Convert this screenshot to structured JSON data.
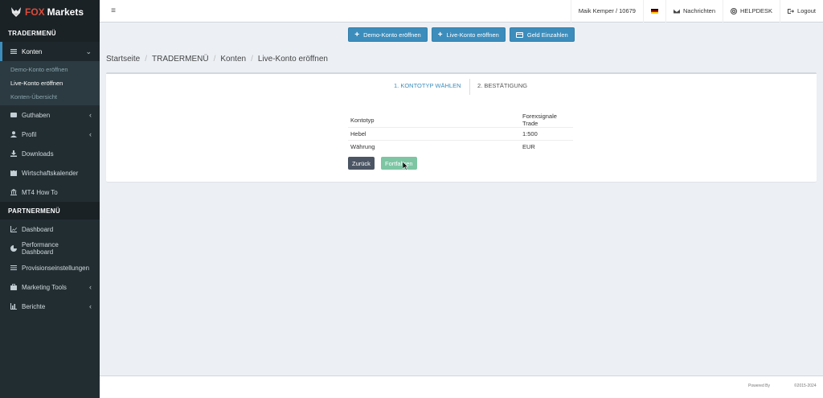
{
  "brand": {
    "fox": "FOX",
    "markets": "Markets"
  },
  "sidebar": {
    "trader_header": "TRADERMENÜ",
    "konten": {
      "label": "Konten"
    },
    "konten_sub": [
      {
        "label": "Demo-Konto eröffnen"
      },
      {
        "label": "Live-Konto eröffnen"
      },
      {
        "label": "Konten-Übersicht"
      }
    ],
    "trader_items": [
      {
        "label": "Guthaben"
      },
      {
        "label": "Profil"
      },
      {
        "label": "Downloads"
      },
      {
        "label": "Wirtschaftskalender"
      },
      {
        "label": "MT4 How To"
      }
    ],
    "partner_header": "PARTNERMENÜ",
    "partner_items": [
      {
        "label": "Dashboard"
      },
      {
        "label": "Performance Dashboard"
      },
      {
        "label": "Provisionseinstellungen"
      },
      {
        "label": "Marketing Tools"
      },
      {
        "label": "Berichte"
      }
    ]
  },
  "topbar": {
    "menu_toggle": "≡",
    "user": "Maik Kemper / 10679",
    "messages": "Nachrichten",
    "helpdesk": "HELPDESK",
    "logout": "Logout"
  },
  "actions": {
    "demo": "Demo-Konto eröffnen",
    "live": "Live-Konto eröffnen",
    "deposit": "Geld Einzahlen"
  },
  "breadcrumb": [
    "Startseite",
    "TRADERMENÜ",
    "Konten",
    "Live-Konto eröffnen"
  ],
  "steps": {
    "step1": "1. KONTOTYP WÄHLEN",
    "step2": "2. BESTÄTIGUNG"
  },
  "details": [
    {
      "key": "Kontotyp",
      "value": "Forexsignale Trade"
    },
    {
      "key": "Hebel",
      "value": "1:500"
    },
    {
      "key": "Währung",
      "value": "EUR"
    }
  ],
  "buttons": {
    "back": "Zurück",
    "next": "Fortfahren"
  },
  "footer": {
    "powered": "Powered By",
    "copyright": "©2015-2024"
  },
  "colors": {
    "sidebar": "#222d32",
    "accent": "#3c8dbc",
    "success": "#7dc5a3",
    "brand_red": "#dd4b39"
  },
  "icons": {
    "konten": "list-icon",
    "guthaben": "wallet-icon",
    "profil": "user-icon",
    "downloads": "download-icon",
    "kalender": "calendar-icon",
    "mt4": "bank-icon",
    "dashboard": "line-chart-icon",
    "performance": "pie-chart-icon",
    "provision": "sliders-icon",
    "marketing": "briefcase-icon",
    "berichte": "bar-chart-icon"
  }
}
